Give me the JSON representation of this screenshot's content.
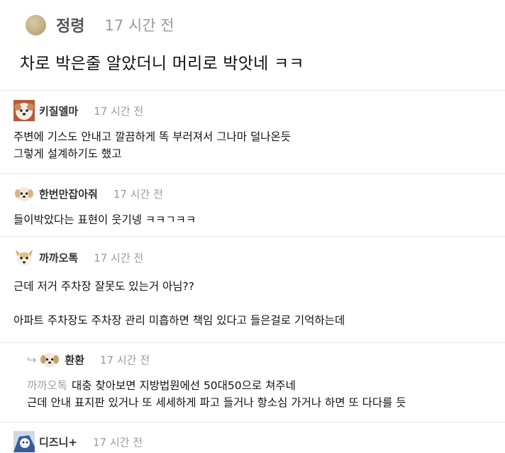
{
  "post": {
    "author": "정령",
    "time": "17 시간 전",
    "title": "차로 박은줄 알았더니 머리로 박앗네 ㅋㅋ"
  },
  "comments": [
    {
      "author": "키질엘마",
      "time": "17 시간 전",
      "lines": [
        "주변에 기스도 안내고 깔끔하게 똑 부러져서 그나마 덜나온듯",
        "그렇게 설계하기도 했고"
      ]
    },
    {
      "author": "한번만잡아줘",
      "time": "17 시간 전",
      "lines": [
        "들이박았다는 표현이 웃기넹 ㅋㅋㄱㅋㅋ"
      ]
    },
    {
      "author": "까까오톡",
      "time": "17 시간 전",
      "lines": [
        "근데 저거 주차장 잘못도 있는거 아님??",
        "아파트 주차장도 주차장 관리 미흡하면 책임 있다고 들은걸로 기억하는데"
      ]
    },
    {
      "author": "환환",
      "time": "17 시간 전",
      "mention": "까까오톡",
      "lines": [
        "대충 찾아보면 지방법원에선 50대50으로 쳐주네",
        "근데 안내 표지판 있거나 또 세세하게 파고 들거나 항소심 가거나 하면 또 다다를 듯"
      ]
    },
    {
      "author": "디즈니+",
      "time": "17 시간 전",
      "lines": []
    }
  ],
  "icons": {
    "reply": "reply-arrow-icon"
  }
}
